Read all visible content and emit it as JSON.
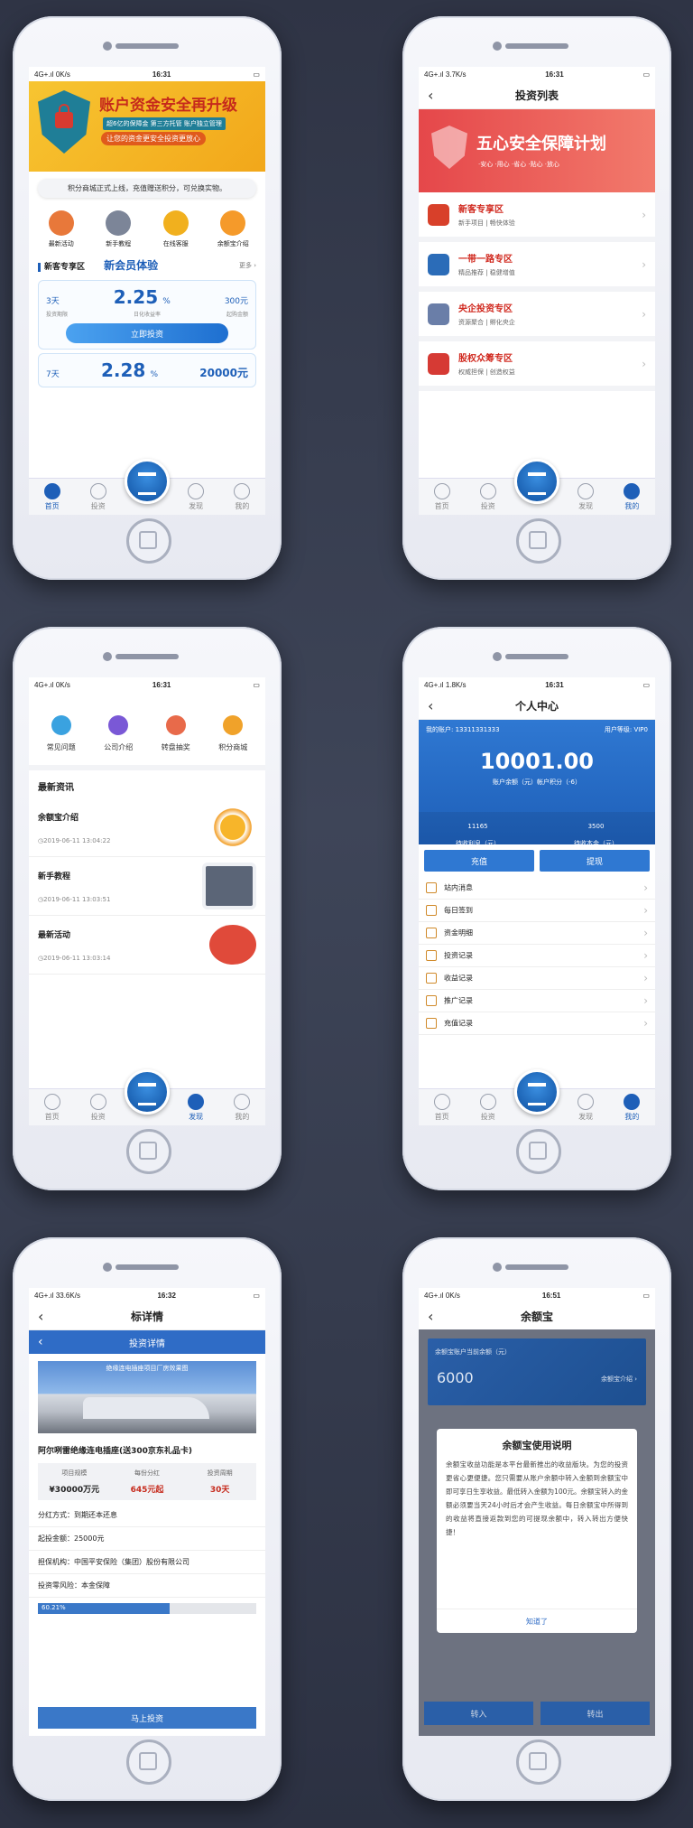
{
  "s1": {
    "status": {
      "carrier": "4G+.ıl",
      "speed": "0K/s",
      "time": "16:31"
    },
    "banner": {
      "title": "账户资金安全再升级",
      "sub1": "超6亿的保障金  第三方托管  账户独立管理",
      "sub2": "让您的资金更安全投资更放心"
    },
    "notice": "积分商城正式上线，充值赠送积分，可兑换实物。",
    "quick": [
      {
        "label": "最新活动"
      },
      {
        "label": "新手教程"
      },
      {
        "label": "在线客服"
      },
      {
        "label": "余额宝介绍"
      }
    ],
    "section": {
      "title": "新客专享区",
      "tag": "新会员体验",
      "more": "更多 ›"
    },
    "card1": {
      "days": "3天",
      "rate": "2.25",
      "rate_unit": "%",
      "amount": "300元",
      "l1": "投资期限",
      "l2": "日化收益率",
      "l3": "起购金额",
      "btn": "立即投资"
    },
    "card2": {
      "days": "7天",
      "rate": "2.28",
      "rate_unit": "%",
      "amount": "20000元"
    },
    "tabs": [
      {
        "label": "首页"
      },
      {
        "label": "投资"
      },
      {
        "label": "发现"
      },
      {
        "label": "我的"
      }
    ]
  },
  "s2": {
    "status": {
      "carrier": "4G+.ıl",
      "speed": "3.7K/s",
      "time": "16:31"
    },
    "title": "投资列表",
    "banner": {
      "title": "五心安全保障计划",
      "sub": "·安心 ·用心 ·省心 ·贴心 ·放心"
    },
    "zones": [
      {
        "name": "新客专享区",
        "desc": "新手项目 | 畅快体验",
        "color": "#d8402a"
      },
      {
        "name": "一带一路专区",
        "desc": "精品推荐 | 稳健增值",
        "color": "#2b6cb8"
      },
      {
        "name": "央企投资专区",
        "desc": "资源聚合 | 孵化央企",
        "color": "#6a7ea8"
      },
      {
        "name": "股权众筹专区",
        "desc": "权威担保 | 创造权益",
        "color": "#d63a34"
      }
    ],
    "tabs": [
      {
        "label": "首页"
      },
      {
        "label": "投资"
      },
      {
        "label": "发现"
      },
      {
        "label": "我的"
      }
    ]
  },
  "s3": {
    "status": {
      "carrier": "4G+.ıl",
      "speed": "0K/s",
      "time": "16:31"
    },
    "icons": [
      {
        "label": "常见问题",
        "color": "#3aa2e0"
      },
      {
        "label": "公司介绍",
        "color": "#7a58d6"
      },
      {
        "label": "转盘抽奖",
        "color": "#e86a4a"
      },
      {
        "label": "积分商城",
        "color": "#f0a22a"
      }
    ],
    "news_title": "最新资讯",
    "news": [
      {
        "title": "余额宝介绍",
        "date": "◷2019-06-11 13:04:22",
        "color": "#f2a02a"
      },
      {
        "title": "新手教程",
        "date": "◷2019-06-11 13:03:51",
        "color": "#5b6577"
      },
      {
        "title": "最新活动",
        "date": "◷2019-06-11 13:03:14",
        "color": "#e04a3a"
      }
    ],
    "tabs": [
      {
        "label": "首页"
      },
      {
        "label": "投资"
      },
      {
        "label": "发现"
      },
      {
        "label": "我的"
      }
    ]
  },
  "s4": {
    "status": {
      "carrier": "4G+.ıl",
      "speed": "1.8K/s",
      "time": "16:31"
    },
    "title": "个人中心",
    "account": "我的账户: 13311331333",
    "level": "用户等级: VIP0",
    "balance": "10001.00",
    "balance_label": "账户余额（元）帐户积分（-6）",
    "interest": {
      "value": "11165",
      "label": "待收利息（元）"
    },
    "principal": {
      "value": "3500",
      "label": "待收本金（元）"
    },
    "recharge": "充值",
    "withdraw": "提现",
    "menu": [
      {
        "label": "站内消息"
      },
      {
        "label": "每日签到"
      },
      {
        "label": "资金明细"
      },
      {
        "label": "投资记录"
      },
      {
        "label": "收益记录"
      },
      {
        "label": "推广记录"
      },
      {
        "label": "充值记录"
      }
    ],
    "tabs": [
      {
        "label": "首页"
      },
      {
        "label": "投资"
      },
      {
        "label": "发现"
      },
      {
        "label": "我的"
      }
    ]
  },
  "s5": {
    "status": {
      "carrier": "4G+.ıl",
      "speed": "33.6K/s",
      "time": "16:32"
    },
    "title": "标详情",
    "subtitle": "投资详情",
    "photo_caption": "绝缘连电插座项目厂房效果图",
    "product": "阿尔咧雷绝缘连电插座(送300京东礼品卡)",
    "stats": [
      {
        "label": "项目规模",
        "value": "¥30000万元"
      },
      {
        "label": "每份分红",
        "value": "645元起"
      },
      {
        "label": "投资周期",
        "value": "30天"
      }
    ],
    "rows": [
      "分红方式：到期还本还息",
      "起投金额：25000元",
      "担保机构：中国平安保险（集团）股份有限公司",
      "投资零风险：本金保障"
    ],
    "progress": 0.6021,
    "progress_text": "60.21%",
    "invest_btn": "马上投资"
  },
  "s6": {
    "status": {
      "carrier": "4G+.ıl",
      "speed": "0K/s",
      "time": "16:51"
    },
    "title": "余额宝",
    "card_label": "余额宝账户当前余额（元）",
    "card_value": "6000",
    "card_link": "余额宝介绍 ›",
    "modal_title": "余额宝使用说明",
    "modal_body": "余额宝收益功能是本平台最新推出的收益版块。为您的投资更省心更便捷。您只需要从账户余额中转入金额到余额宝中即可享日生享收益。最低转入金额为100元。余额宝转入的金额必须要当天24小时后才会产生收益。每日余额宝中所得到的收益将直接返款到您的可提现余额中，转入转出方便快捷！",
    "modal_ok": "知道了",
    "in_btn": "转入",
    "out_btn": "转出"
  }
}
